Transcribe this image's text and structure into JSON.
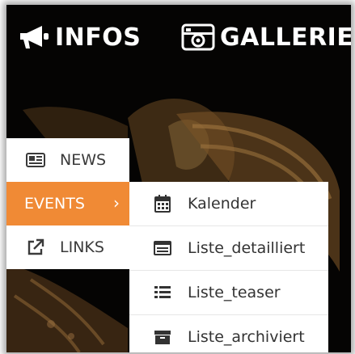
{
  "topnav": {
    "items": [
      {
        "label": "INFOS",
        "icon": "megaphone-icon"
      },
      {
        "label": "GALLERIE",
        "icon": "camera-icon"
      }
    ]
  },
  "menu": {
    "items": [
      {
        "label": "NEWS",
        "icon": "newspaper-icon"
      },
      {
        "label": "EVENTS",
        "icon": "chevron-right-icon",
        "active": true,
        "chevron": "›"
      },
      {
        "label": "LINKS",
        "icon": "external-link-icon"
      }
    ]
  },
  "submenu": {
    "items": [
      {
        "label": "Kalender",
        "icon": "calendar-icon"
      },
      {
        "label": "Liste_detailliert",
        "icon": "list-detail-icon"
      },
      {
        "label": "Liste_teaser",
        "icon": "list-icon"
      },
      {
        "label": "Liste_archiviert",
        "icon": "archive-icon"
      }
    ]
  },
  "colors": {
    "accent": "#f08a35",
    "background": "#050403",
    "menu_bg": "#ffffff",
    "text": "#333333"
  }
}
